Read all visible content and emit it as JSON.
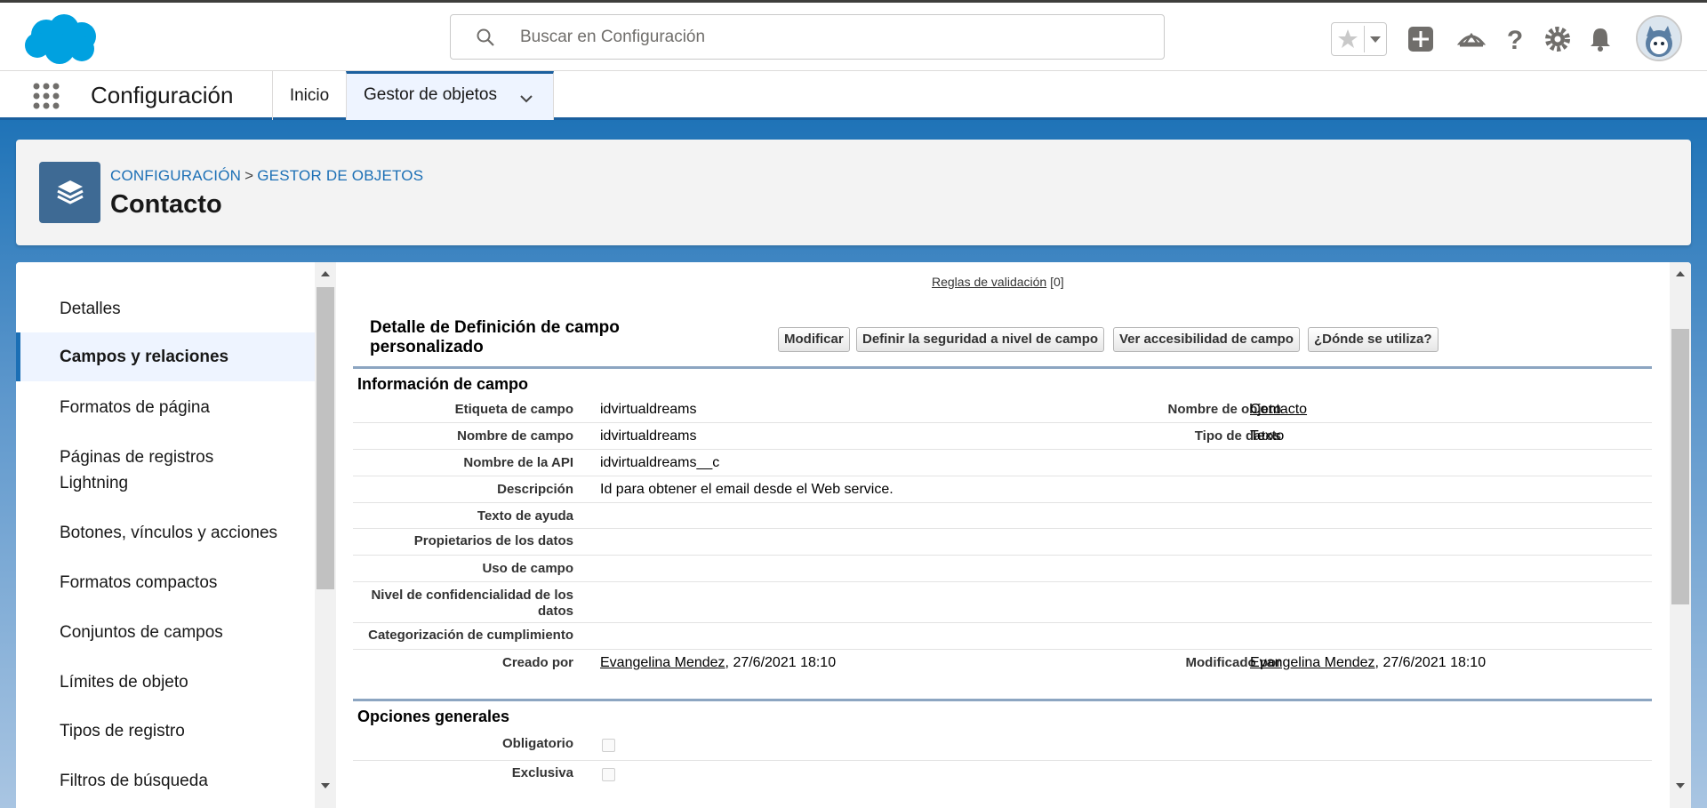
{
  "header": {
    "search_placeholder": "Buscar en Configuración",
    "icons": [
      "search-icon",
      "star-icon",
      "chevron-down-icon",
      "plus-icon",
      "trailhead-icon",
      "help-icon",
      "gear-icon",
      "bell-icon",
      "avatar"
    ],
    "brand_color": "#00a1e0"
  },
  "appnav": {
    "app_title": "Configuración",
    "tabs": [
      {
        "label": "Inicio"
      },
      {
        "label": "Gestor de objetos"
      }
    ]
  },
  "page_header": {
    "breadcrumb": {
      "first": "CONFIGURACIÓN",
      "separator": ">",
      "second": "GESTOR DE OBJETOS"
    },
    "title": "Contacto"
  },
  "left_nav": {
    "items": [
      {
        "label": "Detalles"
      },
      {
        "label": "Campos y relaciones"
      },
      {
        "label": "Formatos de página"
      },
      {
        "label": "Páginas de registros Lightning"
      },
      {
        "label": "Botones, vínculos y acciones"
      },
      {
        "label": "Formatos compactos"
      },
      {
        "label": "Conjuntos de campos"
      },
      {
        "label": "Límites de objeto"
      },
      {
        "label": "Tipos de registro"
      },
      {
        "label": "Filtros de búsqueda"
      }
    ],
    "active_index": 1
  },
  "content": {
    "validation_link": "Reglas de validación",
    "validation_count": "[0]",
    "detail_title": "Detalle de Definición de campo personalizado",
    "buttons": {
      "modify": "Modificar",
      "field_security": "Definir la seguridad a nivel de campo",
      "accessibility": "Ver accesibilidad de campo",
      "where_used": "¿Dónde se utiliza?"
    },
    "field_info": {
      "section_title": "Información de campo",
      "rows": {
        "field_label": {
          "label": "Etiqueta de campo",
          "value": "idvirtualdreams"
        },
        "object_name": {
          "label": "Nombre de objeto",
          "value": "Contacto"
        },
        "field_name": {
          "label": "Nombre de campo",
          "value": "idvirtualdreams"
        },
        "data_type": {
          "label": "Tipo de datos",
          "value": "Texto"
        },
        "api_name": {
          "label": "Nombre de la API",
          "value": "idvirtualdreams__c"
        },
        "description": {
          "label": "Descripción",
          "value": "Id para obtener el email desde el Web service."
        },
        "help_text": {
          "label": "Texto de ayuda",
          "value": ""
        },
        "data_owners": {
          "label": "Propietarios de los datos",
          "value": ""
        },
        "field_usage": {
          "label": "Uso de campo",
          "value": ""
        },
        "data_sensitivity": {
          "label": "Nivel de confidencialidad de los datos",
          "value": ""
        },
        "compliance": {
          "label": "Categorización de cumplimiento",
          "value": ""
        },
        "created_by": {
          "label": "Creado por",
          "user": "Evangelina Mendez",
          "date": ", 27/6/2021 18:10"
        },
        "modified_by": {
          "label": "Modificado por",
          "user": "Evangelina Mendez",
          "date": ", 27/6/2021 18:10"
        }
      }
    },
    "general_options": {
      "section_title": "Opciones generales",
      "required": {
        "label": "Obligatorio",
        "checked": false
      },
      "unique": {
        "label": "Exclusiva",
        "checked": false
      }
    }
  }
}
